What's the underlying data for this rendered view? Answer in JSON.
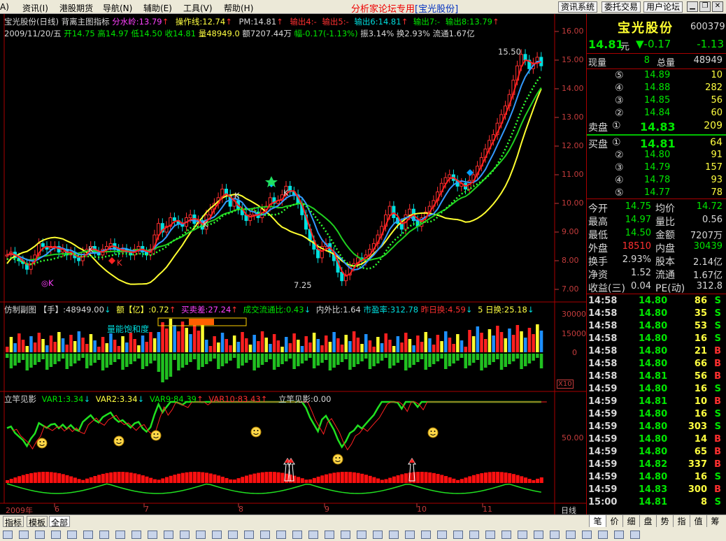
{
  "menu": {
    "left_frag": "A)",
    "items": [
      "资讯(I)",
      "港股期货",
      "导航(N)",
      "辅助(E)",
      "工具(V)",
      "帮助(H)"
    ],
    "center_title": "分析家论坛专用",
    "center_stock": "[宝光股份]",
    "buttons": [
      "资讯系统",
      "委托交易",
      "用户论坛"
    ]
  },
  "chart": {
    "header": {
      "title": "宝光股份(日线)",
      "indicator": "背离主图指标",
      "fenshui": "分水岭:13.79",
      "caozuo": "操作线:12.74",
      "pm": "PM:14.81",
      "out4": "输出4:-",
      "out5": "输出5:-",
      "out6": "输出6:14.81",
      "out7": "输出7:-",
      "out8": "输出8:13.79"
    },
    "info": {
      "date": "2009/11/20/五",
      "open": "开14.75",
      "high": "高14.97",
      "low": "低14.50",
      "close": "收14.81",
      "vol": "量48949.0",
      "amt": "额7207.44万",
      "fu": "幅-0.17(-1.13%)",
      "zhen": "振3.14%",
      "huan": "换2.93%",
      "liutong": "流通1.67亿"
    },
    "price_axis": [
      "16.00",
      "15.00",
      "14.00",
      "13.00",
      "12.00",
      "11.00",
      "10.00",
      "9.00",
      "8.00",
      "7.00"
    ],
    "annotations": {
      "high": "15.50",
      "low": "7.25",
      "k": "K",
      "ok": "◎K"
    },
    "vol_header": {
      "title": "仿制副图",
      "shou": "【手】:48949.00",
      "yi": "额【亿】:0.72",
      "maimai": "买卖差:27.24",
      "liutongbi": "成交流通比:0.43",
      "neiwai": "内外比:1.64",
      "pe": "市盈率:312.78",
      "zuohuan": "昨日换:4.59",
      "wuhuan": "5 日换:25.18"
    },
    "vol_label": "量能饱和度",
    "vol_axis": [
      "30000",
      "15000",
      "0"
    ],
    "vol_unit": "X10",
    "ind_header": {
      "title": "立竿见影",
      "var1": "VAR1:3.34",
      "var2": "VAR2:3.34",
      "var9": "VAR9:84.39",
      "var10": "VAR10:83.43",
      "lg": "立竿见影:0.00"
    },
    "ind_axis": [
      "50.00"
    ],
    "x_axis": {
      "year": "2009年",
      "months": [
        "6",
        "7",
        "8",
        "9",
        "10",
        "11"
      ],
      "period": "日线"
    }
  },
  "quote": {
    "name": "宝光股份",
    "code": "600379",
    "price": "14.81",
    "unit": "元",
    "change": "▼-0.17",
    "change2": "-1.13",
    "xianliang_label": "现量",
    "xianliang": "8",
    "zongliang_label": "总量",
    "zongliang": "48949",
    "asks": [
      {
        "n": "⑤",
        "p": "14.89",
        "v": "10"
      },
      {
        "n": "④",
        "p": "14.88",
        "v": "282"
      },
      {
        "n": "③",
        "p": "14.85",
        "v": "56"
      },
      {
        "n": "②",
        "p": "14.84",
        "v": "60"
      },
      {
        "n": "①",
        "p": "14.83",
        "v": "209",
        "label": "卖盘"
      }
    ],
    "bids": [
      {
        "n": "①",
        "p": "14.81",
        "v": "64",
        "label": "买盘"
      },
      {
        "n": "②",
        "p": "14.80",
        "v": "91"
      },
      {
        "n": "③",
        "p": "14.79",
        "v": "157"
      },
      {
        "n": "④",
        "p": "14.78",
        "v": "93"
      },
      {
        "n": "⑤",
        "p": "14.77",
        "v": "78"
      }
    ],
    "stats": [
      {
        "l1": "今开",
        "v1": "14.75",
        "c1": "green",
        "l2": "均价",
        "v2": "14.72",
        "c2": "green"
      },
      {
        "l1": "最高",
        "v1": "14.97",
        "c1": "green",
        "l2": "量比",
        "v2": "0.56",
        "c2": "white"
      },
      {
        "l1": "最低",
        "v1": "14.50",
        "c1": "green",
        "l2": "金额",
        "v2": "7207万",
        "c2": "white"
      },
      {
        "l1": "外盘",
        "v1": "18510",
        "c1": "red",
        "l2": "内盘",
        "v2": "30439",
        "c2": "green"
      },
      {
        "l1": "换手",
        "v1": "2.93%",
        "c1": "white",
        "l2": "股本",
        "v2": "2.14亿",
        "c2": "white"
      },
      {
        "l1": "净资",
        "v1": "1.52",
        "c1": "white",
        "l2": "流通",
        "v2": "1.67亿",
        "c2": "white"
      },
      {
        "l1": "收益(三)",
        "v1": "0.04",
        "c1": "white",
        "l2": "PE(动)",
        "v2": "312.8",
        "c2": "white"
      }
    ],
    "ticks": [
      {
        "t": "14:58",
        "p": "14.80",
        "v": "86",
        "s": "S"
      },
      {
        "t": "14:58",
        "p": "14.80",
        "v": "35",
        "s": "S"
      },
      {
        "t": "14:58",
        "p": "14.80",
        "v": "53",
        "s": "S"
      },
      {
        "t": "14:58",
        "p": "14.80",
        "v": "16",
        "s": "S"
      },
      {
        "t": "14:58",
        "p": "14.80",
        "v": "21",
        "s": "B"
      },
      {
        "t": "14:58",
        "p": "14.80",
        "v": "66",
        "s": "B"
      },
      {
        "t": "14:58",
        "p": "14.81",
        "v": "56",
        "s": "B"
      },
      {
        "t": "14:59",
        "p": "14.80",
        "v": "16",
        "s": "S"
      },
      {
        "t": "14:59",
        "p": "14.81",
        "v": "10",
        "s": "B"
      },
      {
        "t": "14:59",
        "p": "14.80",
        "v": "16",
        "s": "S"
      },
      {
        "t": "14:59",
        "p": "14.80",
        "v": "303",
        "s": "S"
      },
      {
        "t": "14:59",
        "p": "14.80",
        "v": "14",
        "s": "B"
      },
      {
        "t": "14:59",
        "p": "14.80",
        "v": "65",
        "s": "B"
      },
      {
        "t": "14:59",
        "p": "14.82",
        "v": "337",
        "s": "B"
      },
      {
        "t": "14:59",
        "p": "14.80",
        "v": "16",
        "s": "S"
      },
      {
        "t": "14:59",
        "p": "14.83",
        "v": "300",
        "s": "B"
      },
      {
        "t": "15:00",
        "p": "14.81",
        "v": "8",
        "s": "S"
      }
    ],
    "tabs": [
      "笔",
      "价",
      "细",
      "盘",
      "势",
      "指",
      "值",
      "筹"
    ]
  },
  "bottom": {
    "tabs": [
      "指标",
      "模板",
      "全部"
    ]
  }
}
